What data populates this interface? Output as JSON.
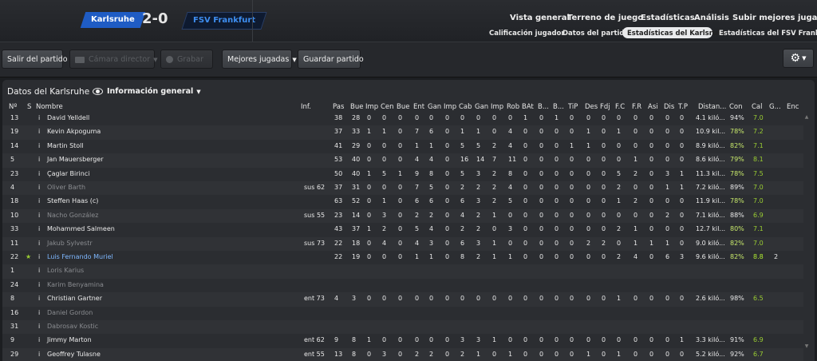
{
  "match": {
    "home": "Karlsruhe",
    "away": "FSV Frankfurt",
    "score": "2-0"
  },
  "nav": {
    "top": [
      "Vista general",
      "Terreno de juego",
      "Estadísticas",
      "Análisis",
      "Subir mejores jugadas"
    ],
    "sub": [
      "Calificación jugador",
      "Datos del partido",
      "Estadísticas del Karlsruhe",
      "Estadísticas del FSV Frankfurt"
    ]
  },
  "toolbar": {
    "exit": "Salir del partido",
    "camera": "Cámara director",
    "record": "Grabar",
    "highlights": "Mejores jugadas",
    "save": "Guardar partido"
  },
  "panel": {
    "title": "Datos del Karlsruhe",
    "view": "Información general"
  },
  "columns": [
    "Nº",
    "S",
    "Nombre",
    "Inf.",
    "Pas",
    "Bue",
    "Imp",
    "Cen",
    "Bue",
    "Ent",
    "Gan",
    "Imp",
    "Cab",
    "Gan",
    "Imp",
    "Rob",
    "BAt",
    "B...",
    "B...",
    "TiP",
    "Des",
    "Fdj",
    "F.C",
    "F.R",
    "Asi",
    "Dis",
    "T.P",
    "Distan...",
    "Con",
    "Cal",
    "G...",
    "Enc"
  ],
  "players": [
    {
      "n": "13",
      "s": "",
      "name": "David Yelldell",
      "inf": "",
      "v": [
        "38",
        "28",
        "0",
        "0",
        "0",
        "0",
        "0",
        "0",
        "0",
        "0",
        "0",
        "0",
        "1",
        "0",
        "1",
        "0",
        "0",
        "0",
        "0",
        "0",
        "0",
        "0",
        "0"
      ],
      "dist": "4.1 kiló...",
      "con": "94%",
      "cal": "7.0",
      "g": "",
      "dim": false,
      "hl": false
    },
    {
      "n": "19",
      "s": "",
      "name": "Kevin Akpoguma",
      "inf": "",
      "v": [
        "37",
        "33",
        "1",
        "1",
        "0",
        "7",
        "6",
        "0",
        "1",
        "1",
        "0",
        "4",
        "0",
        "0",
        "0",
        "0",
        "1",
        "0",
        "1",
        "0",
        "0",
        "0",
        "0"
      ],
      "dist": "10.9 kil...",
      "con": "78%",
      "cal": "7.2",
      "g": "",
      "dim": false,
      "hl": false
    },
    {
      "n": "14",
      "s": "",
      "name": "Martin Stoll",
      "inf": "",
      "v": [
        "41",
        "29",
        "0",
        "0",
        "0",
        "1",
        "1",
        "0",
        "5",
        "5",
        "2",
        "4",
        "0",
        "0",
        "0",
        "1",
        "1",
        "0",
        "0",
        "0",
        "0",
        "0",
        "0"
      ],
      "dist": "8.9 kiló...",
      "con": "82%",
      "cal": "7.1",
      "g": "",
      "dim": false,
      "hl": false
    },
    {
      "n": "5",
      "s": "",
      "name": "Jan Mauersberger",
      "inf": "",
      "v": [
        "53",
        "40",
        "0",
        "0",
        "0",
        "4",
        "4",
        "0",
        "16",
        "14",
        "7",
        "11",
        "0",
        "0",
        "0",
        "0",
        "0",
        "0",
        "0",
        "1",
        "0",
        "0",
        "0"
      ],
      "dist": "8.6 kiló...",
      "con": "79%",
      "cal": "8.1",
      "g": "",
      "dim": false,
      "hl": false
    },
    {
      "n": "23",
      "s": "",
      "name": "Çaglar Birinci",
      "inf": "",
      "v": [
        "50",
        "40",
        "1",
        "5",
        "1",
        "9",
        "8",
        "0",
        "5",
        "3",
        "2",
        "8",
        "0",
        "0",
        "0",
        "0",
        "0",
        "0",
        "5",
        "2",
        "0",
        "3",
        "1"
      ],
      "dist": "11.3 kil...",
      "con": "78%",
      "cal": "7.5",
      "g": "",
      "dim": false,
      "hl": false
    },
    {
      "n": "4",
      "s": "",
      "name": "Oliver Barth",
      "inf": "sus 62",
      "v": [
        "37",
        "31",
        "0",
        "0",
        "0",
        "7",
        "5",
        "0",
        "2",
        "2",
        "2",
        "4",
        "0",
        "0",
        "0",
        "0",
        "0",
        "0",
        "2",
        "0",
        "0",
        "1",
        "1"
      ],
      "dist": "7.2 kiló...",
      "con": "89%",
      "cal": "7.0",
      "g": "",
      "dim": true,
      "hl": false
    },
    {
      "n": "18",
      "s": "",
      "name": "Steffen Haas (c)",
      "inf": "",
      "v": [
        "63",
        "52",
        "0",
        "1",
        "0",
        "6",
        "6",
        "0",
        "6",
        "3",
        "2",
        "5",
        "0",
        "0",
        "0",
        "0",
        "0",
        "0",
        "1",
        "2",
        "0",
        "0",
        "0"
      ],
      "dist": "11.9 kil...",
      "con": "78%",
      "cal": "7.0",
      "g": "",
      "dim": false,
      "hl": false
    },
    {
      "n": "10",
      "s": "",
      "name": "Nacho González",
      "inf": "sus 55",
      "v": [
        "23",
        "14",
        "0",
        "3",
        "0",
        "2",
        "2",
        "0",
        "4",
        "2",
        "1",
        "0",
        "0",
        "0",
        "0",
        "0",
        "0",
        "0",
        "0",
        "0",
        "0",
        "2",
        "0"
      ],
      "dist": "7.1 kiló...",
      "con": "88%",
      "cal": "6.9",
      "g": "",
      "dim": true,
      "hl": false
    },
    {
      "n": "33",
      "s": "",
      "name": "Mohammed Salmeen",
      "inf": "",
      "v": [
        "43",
        "37",
        "1",
        "2",
        "0",
        "5",
        "4",
        "0",
        "2",
        "2",
        "0",
        "3",
        "0",
        "0",
        "0",
        "0",
        "0",
        "0",
        "2",
        "1",
        "0",
        "0",
        "0"
      ],
      "dist": "12.7 kil...",
      "con": "80%",
      "cal": "7.1",
      "g": "",
      "dim": false,
      "hl": false
    },
    {
      "n": "11",
      "s": "",
      "name": "Jakub Sylvestr",
      "inf": "sus 73",
      "v": [
        "22",
        "18",
        "0",
        "4",
        "0",
        "4",
        "3",
        "0",
        "6",
        "3",
        "1",
        "0",
        "0",
        "0",
        "0",
        "0",
        "2",
        "2",
        "0",
        "1",
        "1",
        "1",
        "0"
      ],
      "dist": "9.0 kiló...",
      "con": "82%",
      "cal": "7.0",
      "g": "",
      "dim": true,
      "hl": false
    },
    {
      "n": "22",
      "s": "★",
      "name": "Luis Fernando Muriel",
      "inf": "",
      "v": [
        "22",
        "19",
        "0",
        "0",
        "0",
        "1",
        "1",
        "0",
        "8",
        "2",
        "1",
        "1",
        "0",
        "0",
        "0",
        "0",
        "0",
        "0",
        "2",
        "4",
        "0",
        "6",
        "3"
      ],
      "dist": "9.6 kiló...",
      "con": "82%",
      "cal": "8.8",
      "g": "2",
      "dim": false,
      "hl": true
    },
    {
      "n": "1",
      "s": "",
      "name": "Loris Karius",
      "inf": "",
      "v": [],
      "dist": "",
      "con": "",
      "cal": "",
      "g": "",
      "dim": true,
      "hl": false
    },
    {
      "n": "24",
      "s": "",
      "name": "Karim Benyamina",
      "inf": "",
      "v": [],
      "dist": "",
      "con": "",
      "cal": "",
      "g": "",
      "dim": true,
      "hl": false
    },
    {
      "n": "8",
      "s": "",
      "name": "Christian Gartner",
      "inf": "ent 73",
      "v": [
        "4",
        "3",
        "0",
        "0",
        "0",
        "0",
        "0",
        "0",
        "0",
        "0",
        "0",
        "0",
        "0",
        "0",
        "0",
        "0",
        "0",
        "0",
        "1",
        "0",
        "0",
        "0",
        "0"
      ],
      "dist": "2.6 kiló...",
      "con": "98%",
      "cal": "6.5",
      "g": "",
      "dim": false,
      "hl": false
    },
    {
      "n": "16",
      "s": "",
      "name": "Daniel Gordon",
      "inf": "",
      "v": [],
      "dist": "",
      "con": "",
      "cal": "",
      "g": "",
      "dim": true,
      "hl": false
    },
    {
      "n": "31",
      "s": "",
      "name": "Dabrosav Kostic",
      "inf": "",
      "v": [],
      "dist": "",
      "con": "",
      "cal": "",
      "g": "",
      "dim": true,
      "hl": false
    },
    {
      "n": "9",
      "s": "",
      "name": "Jimmy Marton",
      "inf": "ent 62",
      "v": [
        "9",
        "8",
        "1",
        "0",
        "0",
        "0",
        "0",
        "0",
        "3",
        "3",
        "1",
        "0",
        "0",
        "0",
        "0",
        "0",
        "0",
        "0",
        "0",
        "0",
        "0",
        "0",
        "1"
      ],
      "dist": "3.3 kiló...",
      "con": "91%",
      "cal": "6.9",
      "g": "",
      "dim": false,
      "hl": false
    },
    {
      "n": "29",
      "s": "",
      "name": "Geoffrey Tulasne",
      "inf": "ent 55",
      "v": [
        "13",
        "8",
        "0",
        "3",
        "0",
        "2",
        "2",
        "0",
        "2",
        "1",
        "0",
        "1",
        "0",
        "0",
        "0",
        "0",
        "1",
        "0",
        "1",
        "0",
        "0",
        "0",
        "0"
      ],
      "dist": "5.2 kiló...",
      "con": "92%",
      "cal": "6.7",
      "g": "",
      "dim": false,
      "hl": false
    }
  ],
  "icons": {
    "info": "i",
    "gear": "⚙",
    "caret": "▼"
  }
}
